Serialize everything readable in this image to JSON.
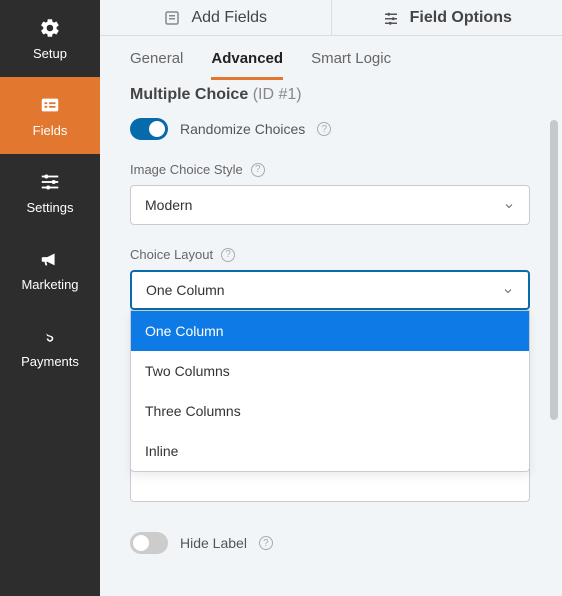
{
  "sidebar": {
    "items": [
      {
        "label": "Setup"
      },
      {
        "label": "Fields"
      },
      {
        "label": "Settings"
      },
      {
        "label": "Marketing"
      },
      {
        "label": "Payments"
      }
    ]
  },
  "tabs": {
    "add_fields": "Add Fields",
    "field_options": "Field Options"
  },
  "subtabs": {
    "general": "General",
    "advanced": "Advanced",
    "smart_logic": "Smart Logic"
  },
  "field": {
    "title": "Multiple Choice",
    "id_label": "(ID #1)"
  },
  "randomize": {
    "label": "Randomize Choices"
  },
  "image_style": {
    "label": "Image Choice Style",
    "value": "Modern"
  },
  "choice_layout": {
    "label": "Choice Layout",
    "value": "One Column",
    "options": [
      "One Column",
      "Two Columns",
      "Three Columns",
      "Inline"
    ]
  },
  "hide_label": {
    "label": "Hide Label"
  }
}
